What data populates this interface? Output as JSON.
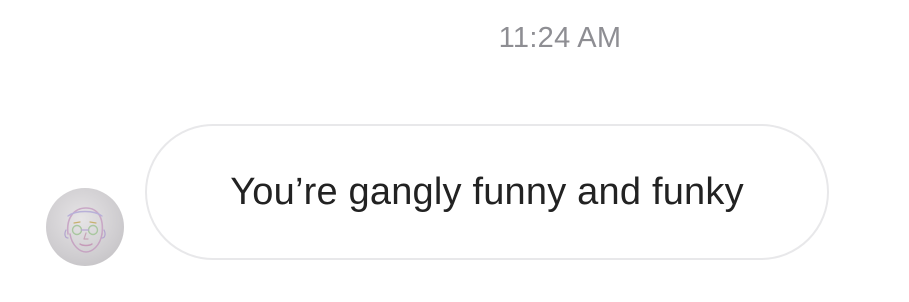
{
  "message": {
    "timestamp": "11:24 AM",
    "text": "You’re gangly funny and funky",
    "sender_avatar_icon": "face-sketch-avatar"
  }
}
